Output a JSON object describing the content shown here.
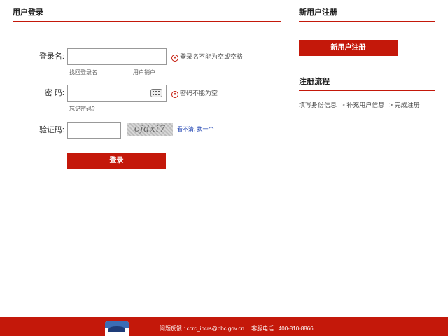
{
  "login": {
    "title": "用户登录",
    "username_label": "登录名:",
    "username_value": "",
    "username_error": "登录名不能为空或空格",
    "retrieve_username": "找回登录名",
    "user_cancel": "用户销户",
    "password_label": "密  码:",
    "password_value": "",
    "password_error": "密码不能为空",
    "forgot_password": "忘记密码?",
    "captcha_label": "验证码:",
    "captcha_value": "",
    "captcha_image_text": "cjdxi7",
    "refresh_captcha": "看不清, 换一个",
    "submit": "登录"
  },
  "register": {
    "title": "新用户注册",
    "button": "新用户注册"
  },
  "flow": {
    "title": "注册流程",
    "steps": [
      "填写身份信息",
      "> 补充用户信息",
      "> 完成注册"
    ]
  },
  "footer": {
    "feedback": "问题反馈 : ccrc_ipcrs@pbc.gov.cn",
    "phone": "客服电话 : 400-810-8866"
  },
  "colors": {
    "accent": "#c4180a",
    "link": "#1a3fb0"
  },
  "icons": {
    "error": "error-circle-icon",
    "keyboard": "keyboard-icon",
    "logo": "pbc-logo"
  }
}
